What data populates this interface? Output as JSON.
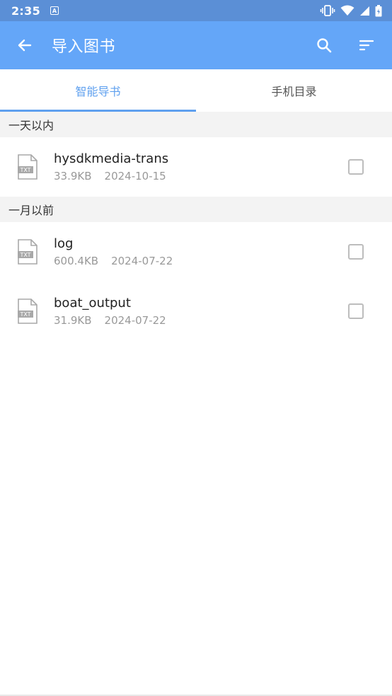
{
  "status_bar": {
    "time": "2:35",
    "notif_icon_letter": "A"
  },
  "app_bar": {
    "title": "导入图书"
  },
  "tabs": [
    {
      "label": "智能导书",
      "active": true
    },
    {
      "label": "手机目录",
      "active": false
    }
  ],
  "sections": [
    {
      "header": "一天以内",
      "files": [
        {
          "name": "hysdkmedia-trans",
          "size": "33.9KB",
          "date": "2024-10-15",
          "type": "TXT"
        }
      ]
    },
    {
      "header": "一月以前",
      "files": [
        {
          "name": "log",
          "size": "600.4KB",
          "date": "2024-07-22",
          "type": "TXT"
        },
        {
          "name": "boat_output",
          "size": "31.9KB",
          "date": "2024-07-22",
          "type": "TXT"
        }
      ]
    }
  ],
  "colors": {
    "status_bar": "#5b8fd6",
    "app_bar": "#64a6f8",
    "accent": "#5fa0ef",
    "section_bg": "#f3f3f3"
  }
}
